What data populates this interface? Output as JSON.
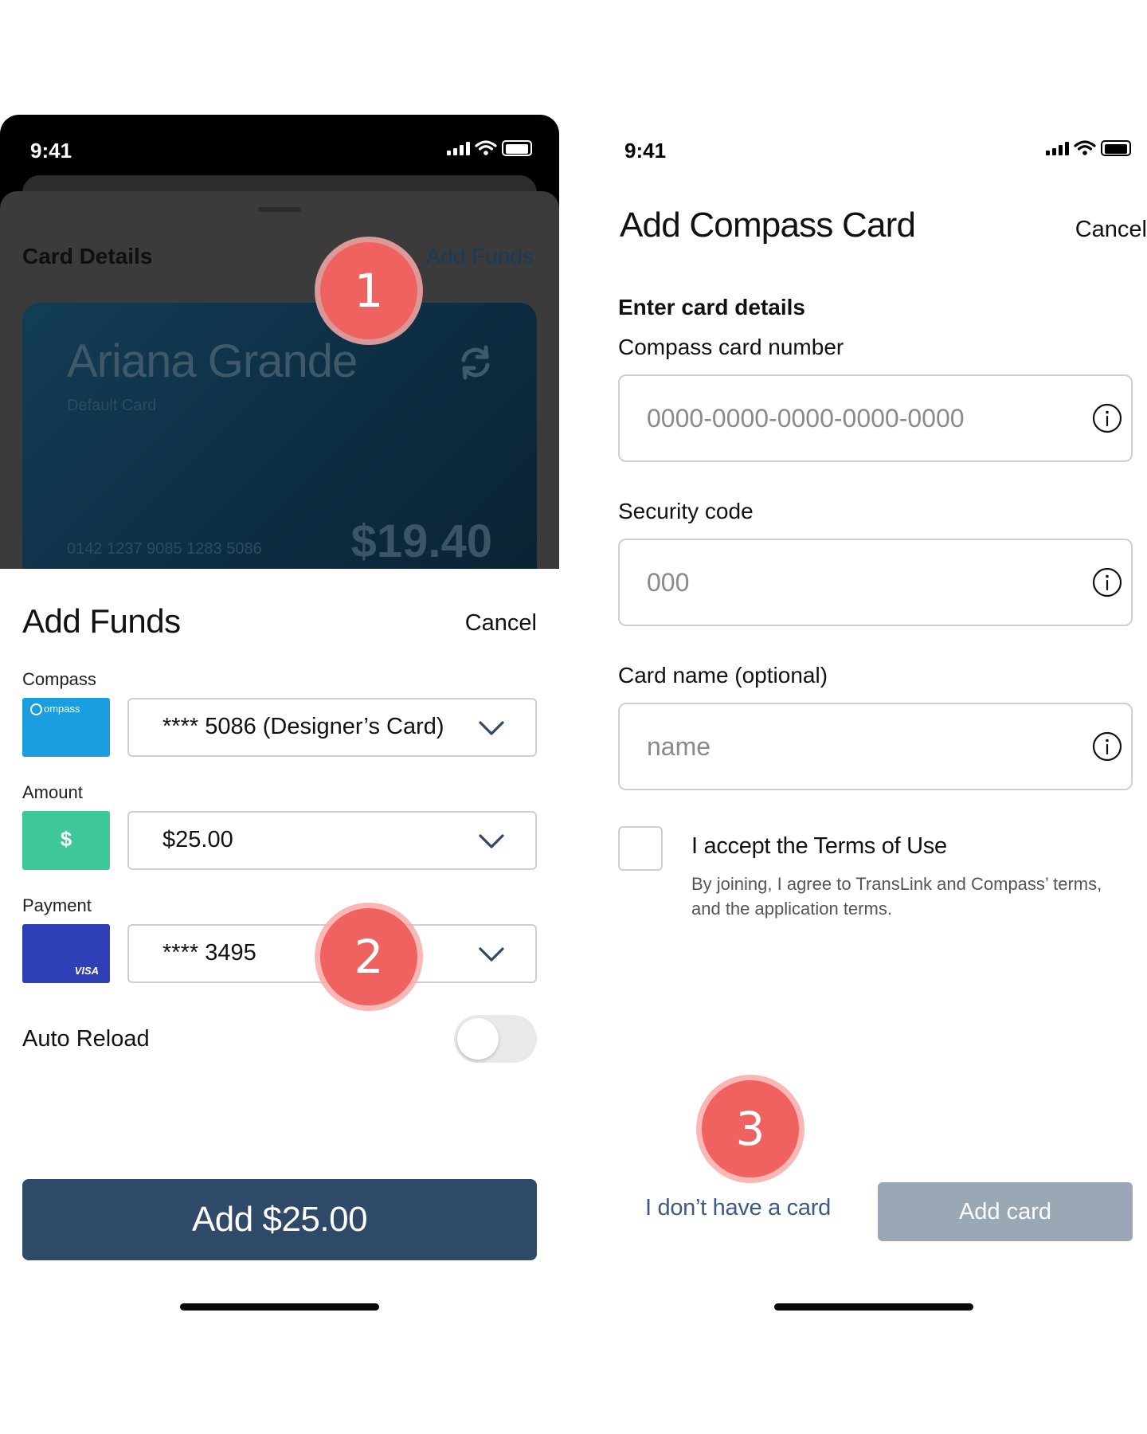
{
  "left_screen": {
    "status": {
      "time": "9:41"
    },
    "background_sheet": {
      "title": "Card Details",
      "add_funds_link": "Add Funds",
      "card": {
        "holder": "Ariana Grande",
        "subtitle": "Default Card",
        "number": "0142 1237 9085 1283 5086",
        "balance": "$19.40"
      }
    },
    "sheet": {
      "title": "Add Funds",
      "cancel": "Cancel",
      "compass_label": "Compass",
      "compass_tile_text": "ompass",
      "compass_value": "**** 5086 (Designer’s Card)",
      "amount_label": "Amount",
      "amount_tile_text": "$",
      "amount_value": "$25.00",
      "payment_label": "Payment",
      "payment_tile_text": "VISA",
      "payment_value": "**** 3495",
      "auto_reload_label": "Auto Reload",
      "auto_reload_on": false,
      "primary_button": "Add $25.00"
    }
  },
  "right_screen": {
    "status": {
      "time": "9:41"
    },
    "title": "Add Compass Card",
    "cancel": "Cancel",
    "section": "Enter card details",
    "card_number_label": "Compass card number",
    "card_number_placeholder": "0000-0000-0000-0000-0000",
    "security_label": "Security code",
    "security_placeholder": "000",
    "name_label": "Card name (optional)",
    "name_placeholder": "name",
    "terms_title": "I accept the Terms of Use",
    "terms_body": "By joining, I agree to TransLink and Compass’ terms, and the application terms.",
    "no_card_link": "I don’t have a card",
    "add_button": "Add card"
  },
  "markers": [
    "1",
    "2",
    "3"
  ],
  "colors": {
    "primary_button": "#2f4a68",
    "disabled_button": "#9aa8b6",
    "marker": "#f0625f",
    "compass_tile": "#1a9ee0",
    "amount_tile": "#3ec79a",
    "payment_tile": "#2f3fb5",
    "link": "#3d5a80"
  }
}
